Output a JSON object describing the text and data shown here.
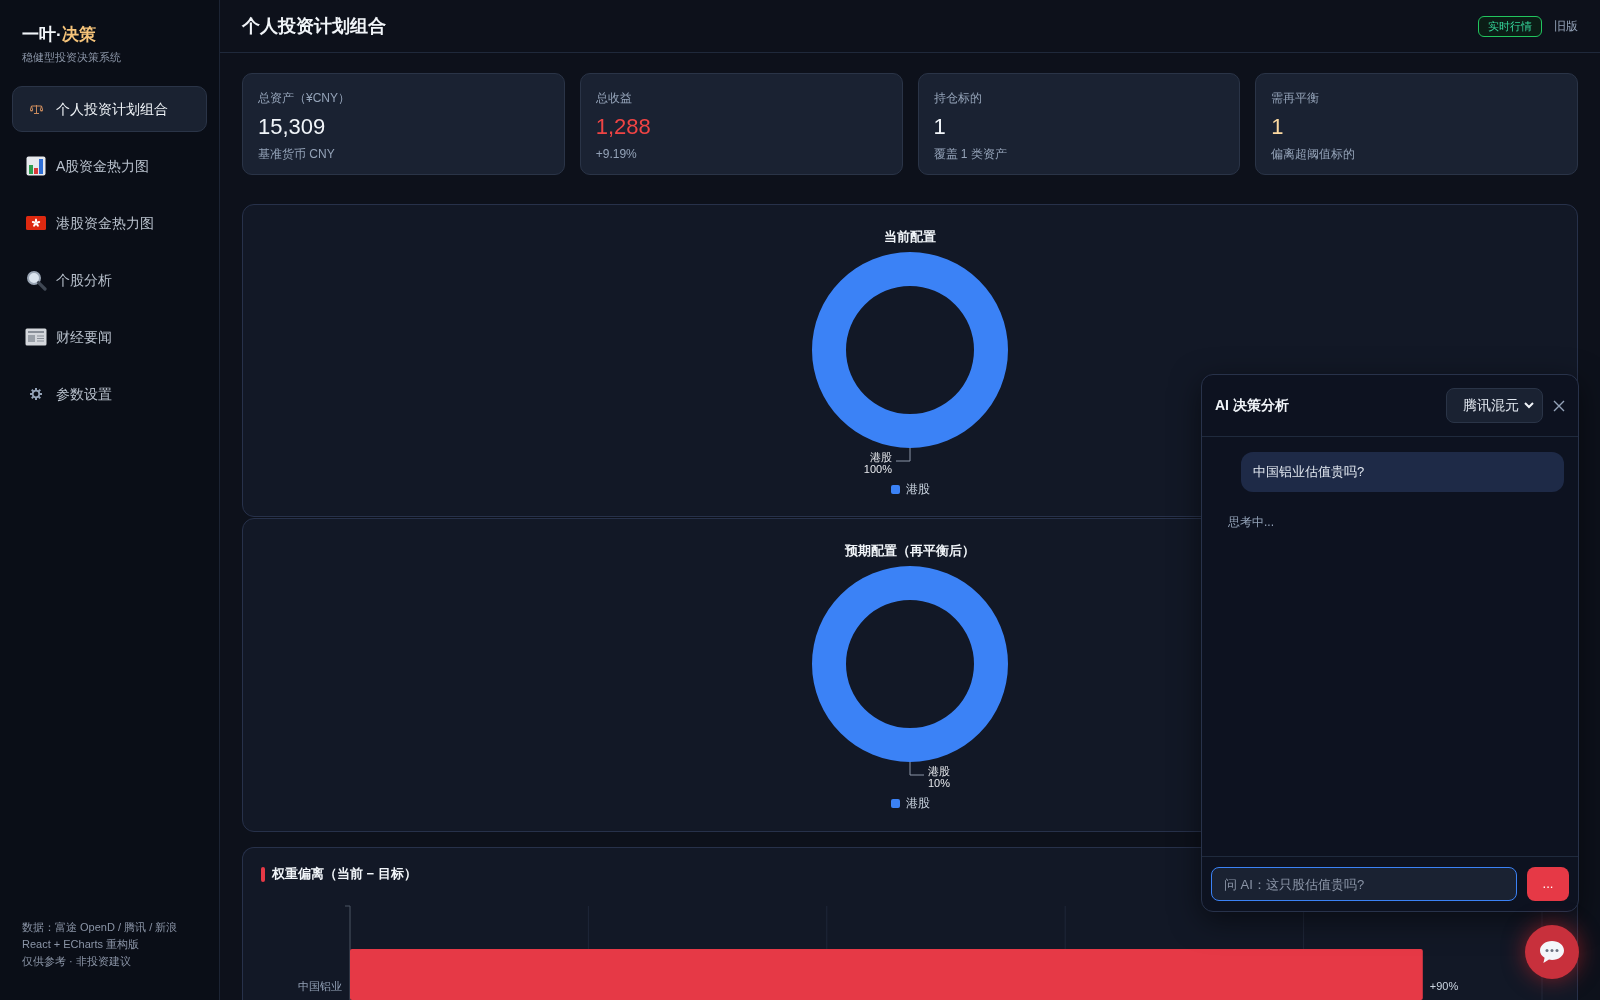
{
  "sidebar": {
    "brand": "一叶·",
    "brand_accent": "决策",
    "subtitle": "稳健型投资决策系统",
    "nav": [
      {
        "label": "个人投资计划组合",
        "selected": true
      },
      {
        "label": "A股资金热力图",
        "selected": false
      },
      {
        "label": "港股资金热力图",
        "selected": false
      },
      {
        "label": "个股分析",
        "selected": false
      },
      {
        "label": "财经要闻",
        "selected": false
      },
      {
        "label": "参数设置",
        "selected": false
      }
    ],
    "footer": [
      "数据：富途 OpenD / 腾讯 / 新浪",
      "React + ECharts 重构版",
      "仅供参考 · 非投资建议"
    ]
  },
  "header": {
    "title": "个人投资计划组合",
    "badge": "实时行情",
    "link": "旧版"
  },
  "stats": [
    {
      "label": "总资产（¥CNY）",
      "value": "15,309",
      "note": "基准货币 CNY",
      "color": "#f1f5f9"
    },
    {
      "label": "总收益",
      "value": "1,288",
      "note": "+9.19%",
      "color": "#ef4444"
    },
    {
      "label": "持仓标的",
      "value": "1",
      "note": "覆盖 1 类资产",
      "color": "#f1f5f9"
    },
    {
      "label": "需再平衡",
      "value": "1",
      "note": "偏离超阈值标的",
      "color": "#fcd9a0"
    }
  ],
  "allocation_charts": [
    {
      "title": "当前配置",
      "slices": [
        {
          "label": "港股",
          "value_label": "100%"
        }
      ],
      "legend": [
        "港股"
      ]
    },
    {
      "title": "预期配置（再平衡后）",
      "slices": [
        {
          "label": "港股",
          "value_label": "10%"
        }
      ],
      "legend": [
        "港股"
      ]
    }
  ],
  "deviation": {
    "title": "权重偏离（当前 − 目标）",
    "chart_data": {
      "type": "bar",
      "orientation": "horizontal",
      "categories": [
        "中国铝业"
      ],
      "values": [
        90
      ],
      "value_labels": [
        "+90%"
      ]
    }
  },
  "ai_chat": {
    "title": "AI 决策分析",
    "model": "腾讯混元",
    "messages": [
      {
        "kind": "user",
        "text": "中国铝业估值贵吗?"
      }
    ],
    "status": "思考中...",
    "input": {
      "placeholder": "问 AI：这只股估值贵吗?",
      "focused": true
    },
    "send": "..."
  }
}
